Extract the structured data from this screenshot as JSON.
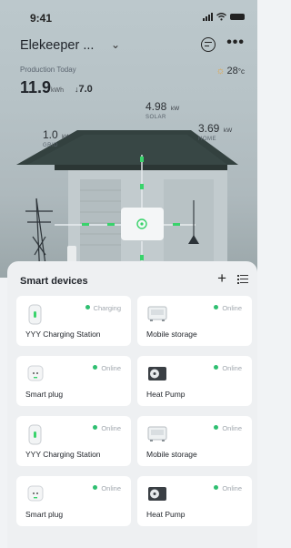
{
  "status_bar": {
    "time": "9:41"
  },
  "header": {
    "home_name": "Elekeeper ...",
    "chevron": "⌄",
    "more": "•••"
  },
  "production": {
    "label": "Production Today",
    "value": "11.9",
    "unit": "kWh",
    "sub_value": "7.0"
  },
  "weather": {
    "icon": "sun-icon",
    "temperature": "28",
    "unit": "°c"
  },
  "energy_flow": {
    "solar": {
      "value": "4.98",
      "unit": "kW",
      "label": "SOLAR"
    },
    "grid": {
      "value": "1.0",
      "unit": "kW",
      "label": "GRID"
    },
    "home": {
      "value": "3.69",
      "unit": "kW",
      "label": "HOME"
    }
  },
  "smart_devices": {
    "title": "Smart devices",
    "add": "+",
    "devices": [
      {
        "name": "YYY Charging Station",
        "status": "Charging",
        "icon": "charger-icon"
      },
      {
        "name": "Mobile storage",
        "status": "Online",
        "icon": "storage-icon"
      },
      {
        "name": "Smart plug",
        "status": "Online",
        "icon": "plug-icon"
      },
      {
        "name": "Heat Pump",
        "status": "Online",
        "icon": "heat-pump-icon"
      },
      {
        "name": "YYY Charging Station",
        "status": "Online",
        "icon": "charger-icon"
      },
      {
        "name": "Mobile storage",
        "status": "Online",
        "icon": "storage-icon"
      },
      {
        "name": "Smart plug",
        "status": "Online",
        "icon": "plug-icon"
      },
      {
        "name": "Heat Pump",
        "status": "Online",
        "icon": "heat-pump-icon"
      }
    ]
  },
  "colors": {
    "online": "#2fbf71",
    "background": "#eef0f2",
    "card": "#ffffff"
  }
}
